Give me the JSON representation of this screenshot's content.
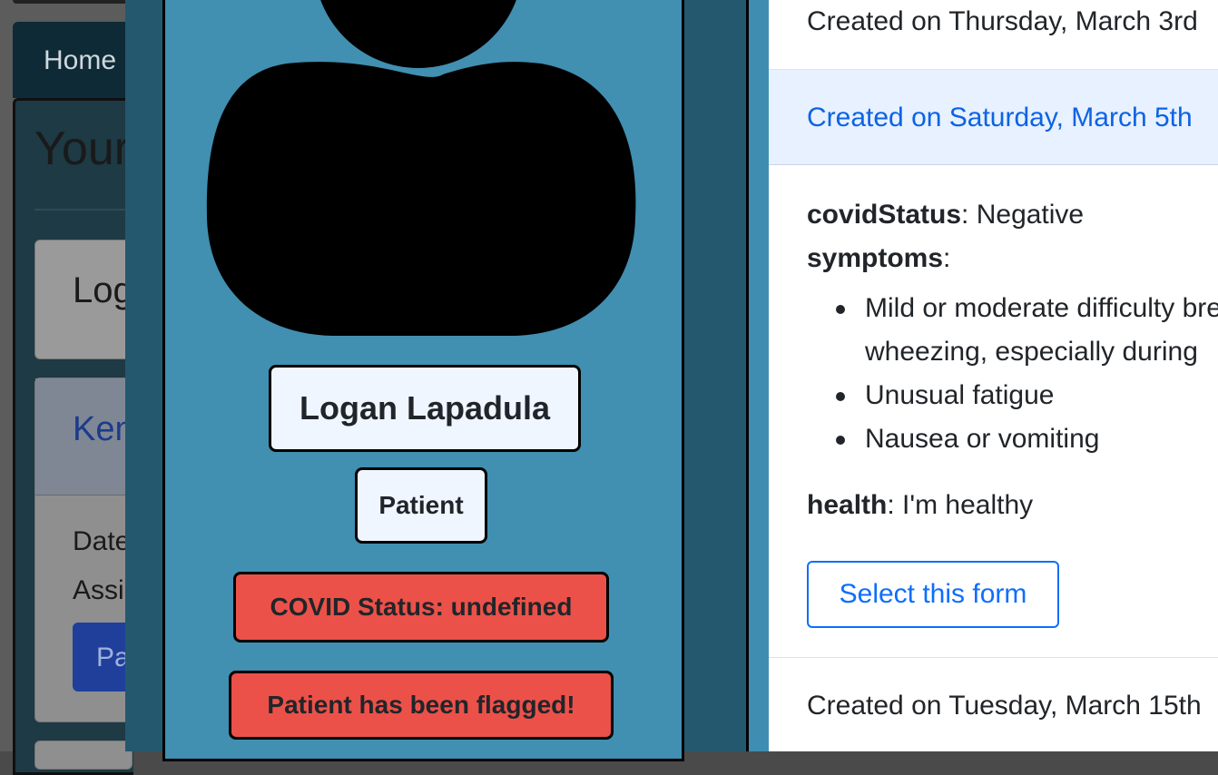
{
  "background": {
    "nav_home": "Home",
    "heading": "Your",
    "card1_text": "Log",
    "card2_link": "Ken",
    "date_label": "Date",
    "assigned_label": "Assi",
    "button_text": "Pa"
  },
  "profile": {
    "avatar_icon": "user-silhouette-icon",
    "name": "Logan Lapadula",
    "role": "Patient",
    "covid_status": "COVID Status: undefined",
    "flag_message": "Patient has been flagged!"
  },
  "forms": {
    "items": [
      {
        "header": "Created on Thursday, March 3rd"
      },
      {
        "header": "Created on Saturday, March 5th"
      },
      {
        "header": "Created on Tuesday, March 15th"
      }
    ],
    "expanded": {
      "covid_key": "covidStatus",
      "covid_value": ": Negative",
      "symptoms_key": "symptoms",
      "symptoms_colon": ":",
      "symptoms": [
        "Mild or moderate difficulty breathing",
        "wheezing, especially during",
        "Unusual fatigue",
        "Nausea or vomiting"
      ],
      "health_key": "health",
      "health_value": ": I'm healthy",
      "select_button": "Select this form"
    }
  },
  "colors": {
    "modal_bg": "#24586f",
    "profile_card": "#418fb1",
    "flag_red": "#ec5149",
    "accent_blue": "#0d6efd"
  }
}
